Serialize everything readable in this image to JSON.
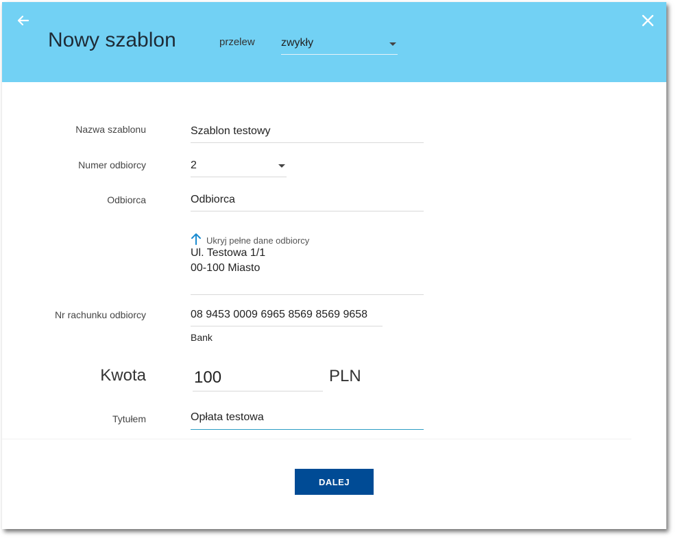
{
  "header": {
    "title": "Nowy szablon",
    "type_label": "przelew",
    "type_value": "zwykły",
    "back_icon": "arrow-left-icon",
    "close_icon": "close-icon",
    "background": "#72d1f4"
  },
  "form": {
    "name_label": "Nazwa szablonu",
    "name_value": "Szablon testowy",
    "recipient_number_label": "Numer odbiorcy",
    "recipient_number_value": "2",
    "recipient_label": "Odbiorca",
    "recipient_value": "Odbiorca",
    "address_toggle_label": "Ukryj pełne dane odbiorcy",
    "address_toggle_icon": "arrow-up-icon",
    "address_line1": "Ul. Testowa 1/1",
    "address_line2": "00-100 Miasto",
    "account_label": "Nr rachunku odbiorcy",
    "account_value": "08 9453 0009 6965 8569 8569 9658",
    "bank_value": "Bank",
    "amount_label": "Kwota",
    "amount_value": "100",
    "currency": "PLN",
    "title_label": "Tytułem",
    "title_value": "Opłata testowa"
  },
  "footer": {
    "next_label": "DALEJ",
    "next_color": "#004b95"
  }
}
